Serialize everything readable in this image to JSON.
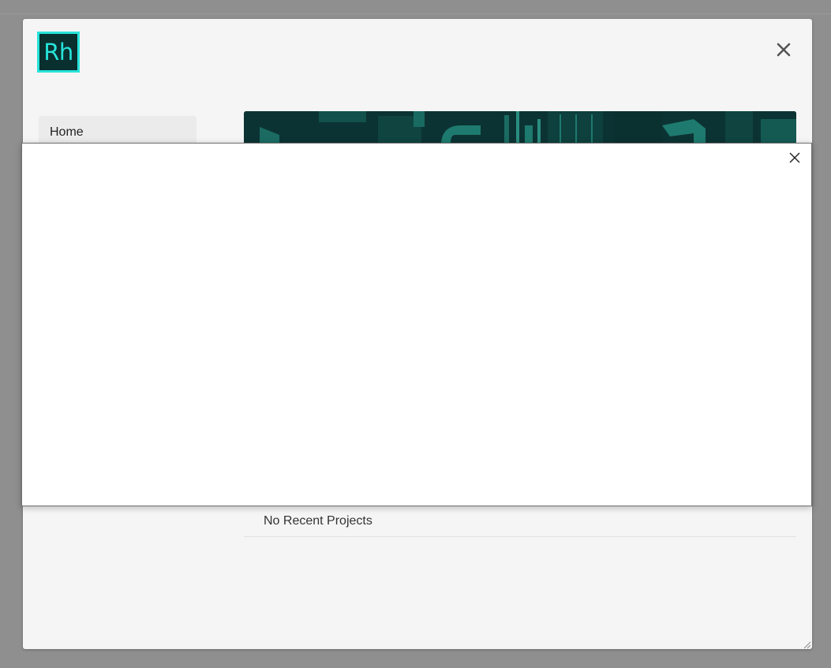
{
  "app": {
    "logo_text": "Rh",
    "accent_color": "#27e3d9",
    "logo_bg_color": "#0a2f2f"
  },
  "sidebar": {
    "items": [
      {
        "label": "Home"
      }
    ]
  },
  "recent_projects": {
    "empty_text": "No Recent Projects"
  },
  "icons": {
    "window_close": "close-icon",
    "dialog_close": "close-icon",
    "resize": "resize-grip-icon"
  }
}
